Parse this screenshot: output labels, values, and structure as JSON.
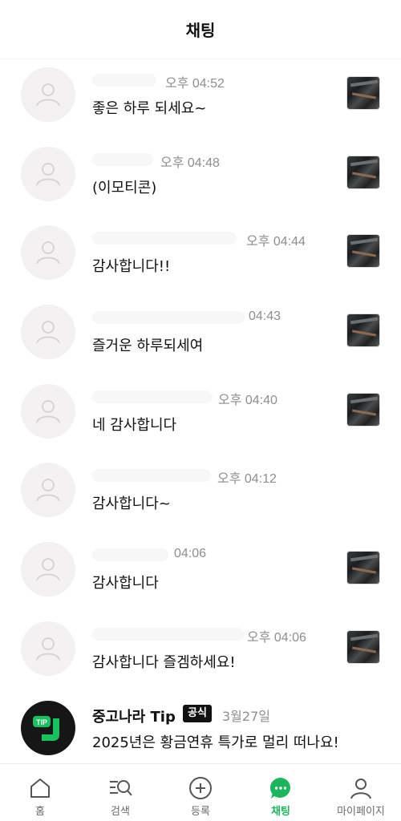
{
  "header": {
    "title": "채팅"
  },
  "chats": [
    {
      "time": "오후 04:52",
      "message": "좋은 하루 되세요~"
    },
    {
      "time": "오후 04:48",
      "message": "(이모티콘)"
    },
    {
      "time": "오후 04:44",
      "message": "감사합니다!!"
    },
    {
      "time": "04:43",
      "message": "즐거운 하루되세여"
    },
    {
      "time": "오후 04:40",
      "message": "네 감사합니다"
    },
    {
      "time": "오후 04:12",
      "message": "감사합니다~"
    },
    {
      "time": "04:06",
      "message": "감사합니다"
    },
    {
      "time": "오후 04:06",
      "message": "감사합니다 즐겜하세요!"
    }
  ],
  "tip": {
    "title": "중고나라 Tip",
    "badge": "공식",
    "date": "3월27일",
    "message": "2025년은 황금연휴 특가로 멀리 떠나요!",
    "logo_text": "TIP"
  },
  "tabs": [
    {
      "label": "홈",
      "icon": "home-icon"
    },
    {
      "label": "검색",
      "icon": "search-icon"
    },
    {
      "label": "등록",
      "icon": "plus-circle-icon"
    },
    {
      "label": "채팅",
      "icon": "chat-bubble-icon"
    },
    {
      "label": "마이페이지",
      "icon": "person-icon"
    }
  ],
  "colors": {
    "accent": "#1bb55c",
    "muted_text": "#8e8e93",
    "avatar_bg": "#f4f1f3"
  }
}
